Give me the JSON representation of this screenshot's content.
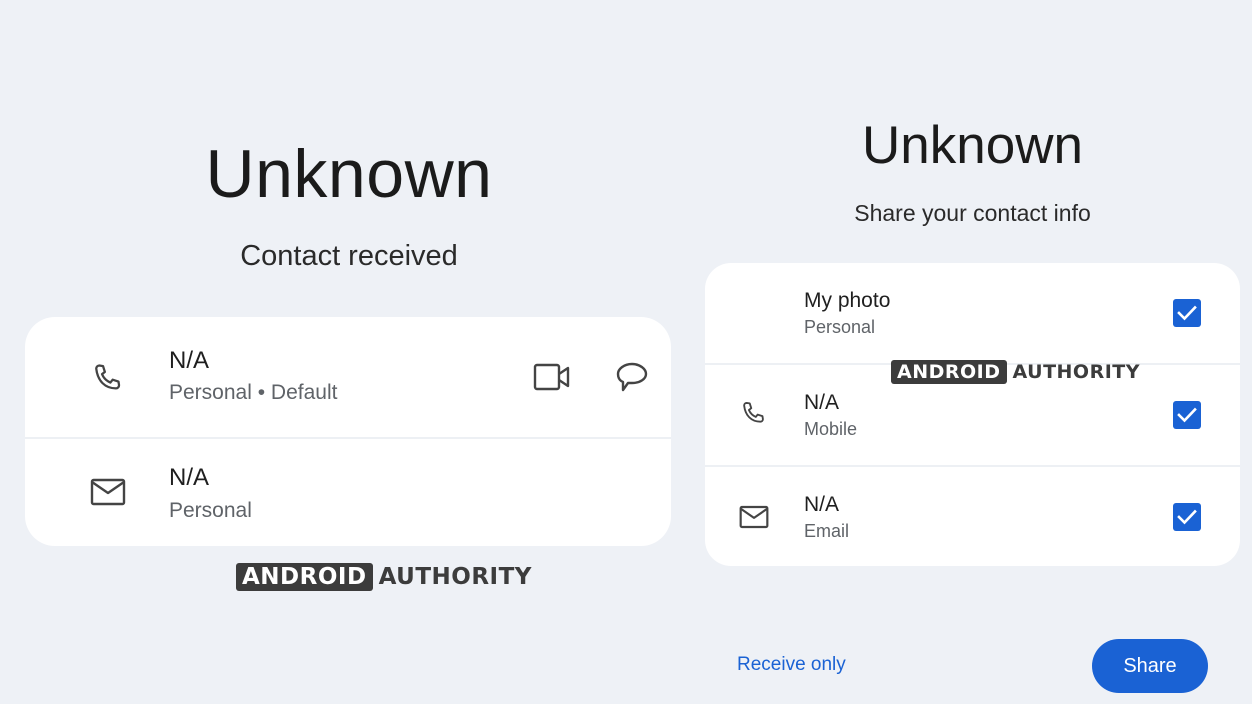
{
  "left_panel": {
    "title": "Unknown",
    "subtitle": "Contact received",
    "phone_row": {
      "value": "N/A",
      "detail": "Personal • Default",
      "icon": "phone-icon",
      "actions": [
        "video-call-icon",
        "message-icon"
      ]
    },
    "email_row": {
      "value": "N/A",
      "detail": "Personal",
      "icon": "email-icon"
    },
    "watermark": {
      "boxed": "ANDROID",
      "plain": "AUTHORITY"
    }
  },
  "right_panel": {
    "title": "Unknown",
    "subtitle": "Share your contact info",
    "items": [
      {
        "label": "My photo",
        "detail": "Personal",
        "checked": true,
        "icon": ""
      },
      {
        "label": "N/A",
        "detail": "Mobile",
        "checked": true,
        "icon": "phone-icon"
      },
      {
        "label": "N/A",
        "detail": "Email",
        "checked": true,
        "icon": "email-icon"
      }
    ],
    "watermark": {
      "boxed": "ANDROID",
      "plain": "AUTHORITY"
    },
    "receive_only_label": "Receive only",
    "share_label": "Share"
  },
  "colors": {
    "background": "#eef1f6",
    "card": "#ffffff",
    "accent": "#1a62d4",
    "secondary_text": "#5f6368"
  }
}
